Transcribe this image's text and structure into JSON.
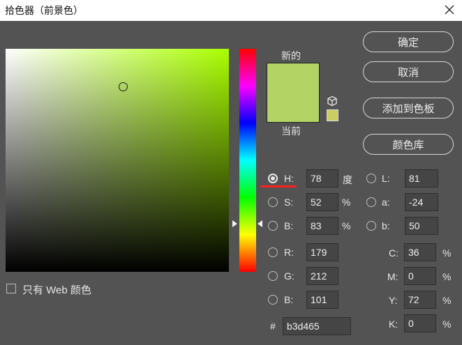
{
  "window": {
    "title": "拾色器（前景色）"
  },
  "preview": {
    "new_label": "新的",
    "current_label": "当前",
    "new_color": "#b3d465",
    "websafe_color": "#cccc66"
  },
  "buttons": {
    "ok": "确定",
    "cancel": "取消",
    "add_swatch": "添加到色板",
    "color_library": "颜色库"
  },
  "hsb": {
    "h_label": "H:",
    "h_value": "78",
    "h_unit": "度",
    "s_label": "S:",
    "s_value": "52",
    "s_unit": "%",
    "b_label": "B:",
    "b_value": "83",
    "b_unit": "%"
  },
  "rgb": {
    "r_label": "R:",
    "r_value": "179",
    "g_label": "G:",
    "g_value": "212",
    "b_label": "B:",
    "b_value": "101"
  },
  "lab": {
    "l_label": "L:",
    "l_value": "81",
    "a_label": "a:",
    "a_value": "-24",
    "b_label": "b:",
    "b_value": "50"
  },
  "cmyk": {
    "c_label": "C:",
    "c_value": "36",
    "c_unit": "%",
    "m_label": "M:",
    "m_value": "0",
    "m_unit": "%",
    "y_label": "Y:",
    "y_value": "72",
    "y_unit": "%",
    "k_label": "K:",
    "k_value": "0",
    "k_unit": "%"
  },
  "hex": {
    "label": "#",
    "value": "b3d465"
  },
  "web_only": {
    "label": "只有 Web 颜色",
    "checked": false
  },
  "icons": {
    "close": "close-icon",
    "gamut": "cube-icon"
  }
}
